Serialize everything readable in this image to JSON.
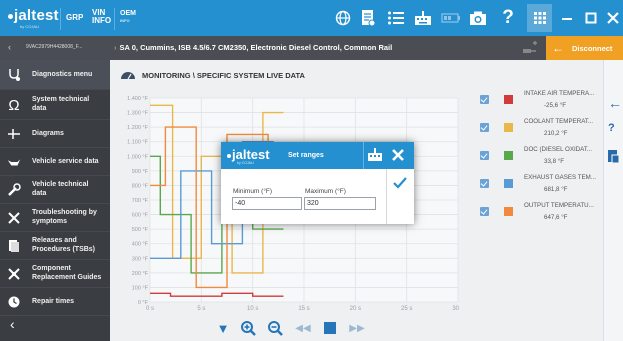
{
  "topbar": {
    "brand": "jaltest",
    "brand_sub": "by COJALI",
    "grp": "GRP",
    "vin_top": "VIN",
    "vin_bottom": "INFO",
    "oem_top": "OEM",
    "oem_bottom": "INFO",
    "icons": [
      "globe-icon",
      "document-icon",
      "list-icon",
      "keyboard-icon",
      "battery-icon",
      "camera-icon",
      "help-icon",
      "grid-icon",
      "minimize-icon",
      "maximize-icon",
      "close-icon"
    ]
  },
  "nav": {
    "vin_code": "9VAC2979H4428008_F...",
    "vehicle": "SA 0, Cummins, ISB 4.5/6.7 CM2350, Electronic Diesel Control, Common Rail",
    "disconnect": "Disconnect"
  },
  "sidebar": {
    "items": [
      {
        "label": "Diagnostics menu",
        "icon": "stethoscope-icon"
      },
      {
        "label": "System technical data",
        "icon": "omega-icon"
      },
      {
        "label": "Diagrams",
        "icon": "diagram-icon"
      },
      {
        "label": "Vehicle service data",
        "icon": "oil-can-icon"
      },
      {
        "label": "Vehicle technical data",
        "icon": "wrench-icon"
      },
      {
        "label": "Troubleshooting by symptoms",
        "icon": "tools-icon"
      },
      {
        "label": "Releases and Procedures (TSBs)",
        "icon": "books-icon"
      },
      {
        "label": "Component Replacement Guides",
        "icon": "component-tools-icon"
      },
      {
        "label": "Repair times",
        "icon": "clock-gear-icon"
      }
    ]
  },
  "main": {
    "title": "MONITORING \\ SPECIFIC SYSTEM LIVE DATA"
  },
  "chart_data": {
    "type": "line",
    "x_ticks": [
      "0 s",
      "5 s",
      "10 s",
      "15 s",
      "20 s",
      "25 s",
      "30 s"
    ],
    "y_ticks": [
      "0 °F",
      "100 °F",
      "200 °F",
      "300 °F",
      "400 °F",
      "500 °F",
      "600 °F",
      "700 °F",
      "800 °F",
      "900 °F",
      "1.000 °F",
      "1.100 °F",
      "1.200 °F",
      "1.300 °F",
      "1.400 °F"
    ],
    "xlim": [
      0,
      30
    ],
    "ylim": [
      0,
      1400
    ],
    "grid": true,
    "series": [
      {
        "name": "INTAKE AIR TEMPERA...",
        "color": "#d23b3b",
        "x": [
          0,
          2,
          2,
          7,
          7,
          10,
          10,
          13
        ],
        "y": [
          60,
          60,
          40,
          40,
          60,
          60,
          40,
          40
        ]
      },
      {
        "name": "COOLANT TEMPERAT...",
        "color": "#e8b84a",
        "x": [
          0,
          2.2,
          2.2,
          5,
          5,
          8,
          8,
          11,
          11,
          13
        ],
        "y": [
          1350,
          1350,
          300,
          300,
          1000,
          1000,
          200,
          200,
          1300,
          1300
        ]
      },
      {
        "name": "DOC (DIESEL OXIDAT...",
        "color": "#5aa84c",
        "x": [
          0,
          1,
          1,
          4,
          4,
          7,
          7,
          10,
          10,
          13
        ],
        "y": [
          1000,
          1000,
          600,
          600,
          200,
          200,
          900,
          900,
          500,
          500
        ]
      },
      {
        "name": "EXHAUST GASES TEM...",
        "color": "#5b9bd5",
        "x": [
          0,
          3,
          3,
          6,
          6,
          9,
          9,
          12,
          12,
          13
        ],
        "y": [
          300,
          300,
          900,
          900,
          400,
          400,
          1100,
          1100,
          700,
          700
        ]
      },
      {
        "name": "OUTPUT TEMPERATU...",
        "color": "#f08a3c",
        "x": [
          0,
          1.5,
          1.5,
          4.5,
          4.5,
          7.5,
          7.5,
          11.5,
          11.5,
          13
        ],
        "y": [
          800,
          800,
          1200,
          1200,
          100,
          100,
          1150,
          1150,
          650,
          650
        ]
      }
    ]
  },
  "legend": [
    {
      "name": "INTAKE AIR TEMPERA...",
      "value": "-25,6 °F",
      "color": "#d23b3b"
    },
    {
      "name": "COOLANT TEMPERAT...",
      "value": "210,2 °F",
      "color": "#e8b84a"
    },
    {
      "name": "DOC (DIESEL OXIDAT...",
      "value": "33,8 °F",
      "color": "#5aa84c"
    },
    {
      "name": "EXHAUST GASES TEM...",
      "value": "681,8 °F",
      "color": "#5b9bd5"
    },
    {
      "name": "OUTPUT TEMPERATU...",
      "value": "647,6 °F",
      "color": "#f08a3c"
    }
  ],
  "dialog": {
    "brand": "jaltest",
    "brand_sub": "by COJALI",
    "title": "Set ranges",
    "min_label": "Minimum (°F)",
    "min_value": "-40",
    "max_label": "Maximum (°F)",
    "max_value": "320"
  },
  "colors": {
    "accent": "#2590cf",
    "sidebar": "#3a3d42",
    "disconnect": "#f0a022"
  }
}
